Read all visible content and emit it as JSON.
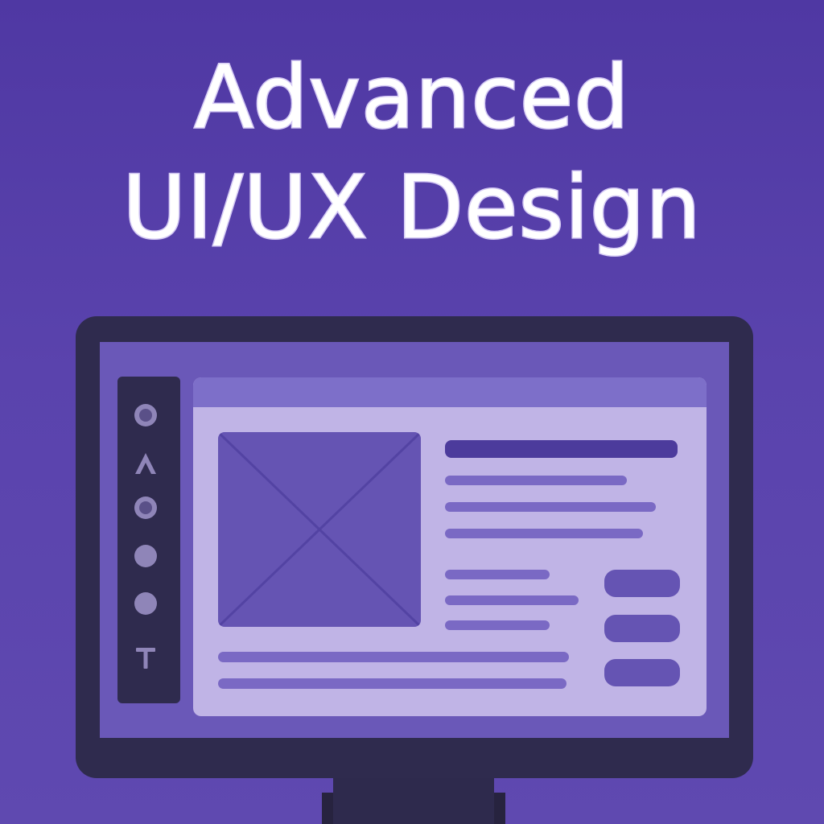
{
  "heading": {
    "line1": "Advanced",
    "line2": "UI/UX Design"
  },
  "colors": {
    "background": "#5a43ad",
    "monitor_frame": "#2f2b4e",
    "screen": "#6a58b8",
    "panel": "#c0b4e6",
    "panel_header": "#7d6fc9",
    "accent_dark": "#4c3b9c",
    "text_line": "#7a69c4",
    "button": "#6554b3",
    "tool_icon": "#8f85b8"
  },
  "toolbar": {
    "tools": [
      {
        "icon": "circle-ring-icon"
      },
      {
        "icon": "triangle-icon"
      },
      {
        "icon": "circle-ring-icon"
      },
      {
        "icon": "circle-filled-icon"
      },
      {
        "icon": "circle-filled-icon"
      },
      {
        "icon": "text-tool-icon"
      }
    ]
  },
  "mockup": {
    "image_placeholder_icon": "image-placeholder-icon",
    "buttons_count_label": ""
  }
}
